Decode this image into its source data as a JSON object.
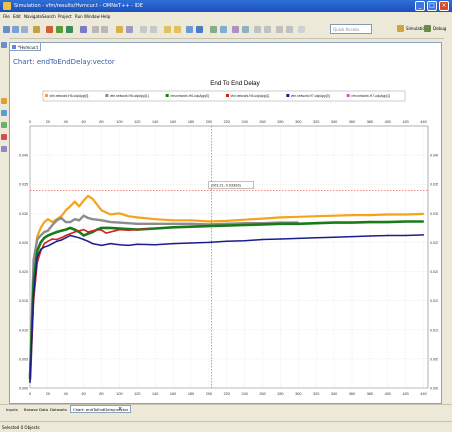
{
  "window": {
    "title": "Simulation - vfm/results/Hvmcur.t - OMNeT++ - IDE"
  },
  "menu": [
    "File",
    "Edit",
    "Navigate",
    "Search",
    "Project",
    "Run",
    "Window",
    "Help"
  ],
  "toolbar": {
    "quick_access_placeholder": "Quick Access",
    "perspective_simulation": "Simulation",
    "perspective_debug": "Debug"
  },
  "editor_tab": {
    "label": "*Hvmcur.t"
  },
  "chart_panel_title": "Chart: endToEndDelay:vector",
  "bottom_tabs": [
    "Inputs",
    "Browse Data",
    "Datasets",
    "Chart: endToEndDelay:vector"
  ],
  "status": {
    "text": "Selected 0 Objects"
  },
  "colors": {
    "series1": "#f5a31a",
    "series2": "#8c8c8c",
    "series3": "#1a7a1a",
    "series4": "#d42020",
    "series5": "#1c1c8c",
    "crosshair": "#cc2222",
    "title_blue": "#3560a8"
  },
  "chart_data": {
    "type": "line",
    "title": "End To End Delay",
    "xlabel": "",
    "ylabel": "",
    "xlim": [
      0,
      445
    ],
    "ylim": [
      0,
      0.045
    ],
    "x_ticks": [
      "0",
      "20",
      "40",
      "60",
      "80",
      "100",
      "120",
      "140",
      "160",
      "180",
      "200",
      "220",
      "240",
      "260",
      "280",
      "300",
      "320",
      "340",
      "360",
      "380",
      "400",
      "420",
      "440"
    ],
    "y_ticks": [
      "0.000",
      "0.005",
      "0.010",
      "0.015",
      "0.020",
      "0.025",
      "0.030",
      "0.035",
      "0.040"
    ],
    "grid": true,
    "legend_position": "top",
    "crosshair_label": "(203.21, 0.03393)",
    "crosshair": {
      "x": 203.21,
      "y": 0.03393
    },
    "series": [
      {
        "name": "vfm.network.H5.udpApp[0]",
        "x": [
          0,
          4,
          8,
          12,
          16,
          20,
          25,
          30,
          35,
          40,
          45,
          50,
          55,
          60,
          65,
          70,
          75,
          80,
          90,
          100,
          110,
          120,
          140,
          160,
          180,
          200,
          220,
          240,
          260,
          280,
          300,
          320,
          340,
          360,
          380,
          400,
          420,
          440
        ],
        "y": [
          0.002,
          0.02,
          0.026,
          0.0275,
          0.0285,
          0.029,
          0.0285,
          0.029,
          0.0295,
          0.0305,
          0.0312,
          0.032,
          0.0312,
          0.0322,
          0.033,
          0.0325,
          0.0315,
          0.0305,
          0.0298,
          0.03,
          0.0295,
          0.0293,
          0.029,
          0.0288,
          0.0288,
          0.0286,
          0.0287,
          0.0289,
          0.0291,
          0.0293,
          0.0294,
          0.0295,
          0.0296,
          0.0297,
          0.0297,
          0.0298,
          0.0298,
          0.0299
        ]
      },
      {
        "name": "vfm.network.H5.udpApp[1]",
        "x": [
          0,
          4,
          8,
          12,
          16,
          20,
          25,
          30,
          35,
          40,
          45,
          50,
          55,
          60,
          65,
          70,
          75,
          80,
          90,
          100,
          110,
          120,
          140,
          160,
          180,
          200,
          220,
          240,
          260,
          280,
          300
        ],
        "y": [
          0.002,
          0.022,
          0.0255,
          0.0262,
          0.0268,
          0.027,
          0.028,
          0.0288,
          0.0292,
          0.0285,
          0.0285,
          0.029,
          0.0288,
          0.0296,
          0.0292,
          0.029,
          0.0289,
          0.0288,
          0.0285,
          0.0284,
          0.0283,
          0.0282,
          0.0282,
          0.0282,
          0.0282,
          0.0281,
          0.0282,
          0.0283,
          0.0283,
          0.0284,
          0.0284
        ]
      },
      {
        "name": "vfm.network.H6.udpApp[0]",
        "x": [
          0,
          4,
          8,
          12,
          16,
          20,
          25,
          30,
          35,
          40,
          45,
          50,
          55,
          60,
          65,
          70,
          75,
          80,
          90,
          100,
          110,
          120,
          140,
          160,
          180,
          200,
          220,
          240,
          260,
          280,
          300,
          320,
          340,
          360,
          380,
          400,
          420,
          440
        ],
        "y": [
          0.0015,
          0.018,
          0.0235,
          0.025,
          0.0258,
          0.0262,
          0.0265,
          0.0268,
          0.027,
          0.0272,
          0.0275,
          0.0272,
          0.0268,
          0.0262,
          0.0265,
          0.0268,
          0.0272,
          0.0275,
          0.0275,
          0.0274,
          0.0273,
          0.0272,
          0.0274,
          0.0276,
          0.0277,
          0.0278,
          0.0279,
          0.028,
          0.0281,
          0.0282,
          0.0282,
          0.0283,
          0.0284,
          0.0284,
          0.0285,
          0.0285,
          0.0286,
          0.0286
        ]
      },
      {
        "name": "vfm.network.H6.udpApp[1]",
        "x": [
          0,
          4,
          8,
          12,
          16,
          20,
          25,
          30,
          35,
          40,
          45,
          50,
          55,
          60,
          65,
          70,
          75,
          80,
          85,
          90,
          95,
          100,
          110,
          120,
          130
        ],
        "y": [
          0.001,
          0.015,
          0.0215,
          0.0235,
          0.0248,
          0.0252,
          0.0256,
          0.0255,
          0.0258,
          0.0262,
          0.0265,
          0.0268,
          0.027,
          0.0272,
          0.0268,
          0.027,
          0.0272,
          0.0271,
          0.0266,
          0.0268,
          0.027,
          0.0272,
          0.0271,
          0.0272,
          0.0273
        ]
      },
      {
        "name": "vfm.network.H7.udpApp[0]",
        "x": [
          0,
          4,
          8,
          12,
          16,
          20,
          25,
          30,
          35,
          40,
          45,
          50,
          55,
          60,
          65,
          70,
          80,
          90,
          100,
          110,
          120,
          140,
          160,
          180,
          200,
          220,
          240,
          260,
          280,
          300,
          320,
          340,
          360,
          380,
          400,
          420,
          440
        ],
        "y": [
          0.001,
          0.016,
          0.0225,
          0.0238,
          0.0242,
          0.0244,
          0.0248,
          0.0252,
          0.0254,
          0.0258,
          0.0262,
          0.026,
          0.0258,
          0.0255,
          0.0252,
          0.0248,
          0.0245,
          0.0248,
          0.0246,
          0.0245,
          0.0247,
          0.0246,
          0.0248,
          0.0249,
          0.025,
          0.0252,
          0.0253,
          0.0255,
          0.0256,
          0.0257,
          0.0258,
          0.0259,
          0.026,
          0.0261,
          0.0262,
          0.0262,
          0.0263
        ]
      },
      {
        "name": "vfm.network.H7.udpApp[1]",
        "x": [],
        "y": []
      }
    ]
  }
}
